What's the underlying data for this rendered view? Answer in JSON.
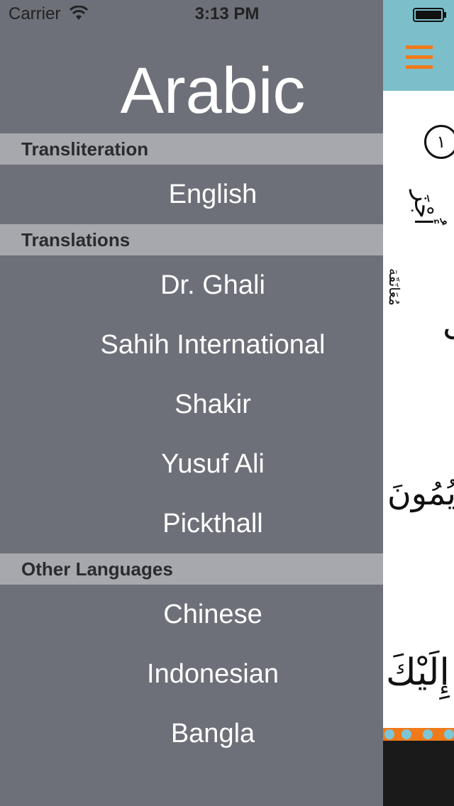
{
  "status_bar": {
    "carrier": "Carrier",
    "time": "3:13 PM"
  },
  "drawer": {
    "title": "Arabic",
    "sections": [
      {
        "header": "Transliteration",
        "items": [
          "English"
        ]
      },
      {
        "header": "Translations",
        "items": [
          "Dr. Ghali",
          "Sahih International",
          "Shakir",
          "Yusuf Ali",
          "Pickthall"
        ]
      },
      {
        "header": "Other Languages",
        "items": [
          "Chinese",
          "Indonesian",
          "Bangla"
        ]
      }
    ]
  },
  "content": {
    "verse_marker": "١",
    "arabic_fragments": [
      "أُجْزَ",
      "ى",
      "مُعَانَقَة",
      "يُمُونَ",
      "إِلَيْكَ"
    ]
  },
  "colors": {
    "drawer_bg": "#6d7079",
    "section_header_bg": "#a6a8ad",
    "nav_bar": "#7cbfca",
    "accent": "#f07a1a"
  },
  "icons": {
    "menu": "hamburger-icon",
    "wifi": "wifi-icon",
    "battery": "battery-icon"
  }
}
